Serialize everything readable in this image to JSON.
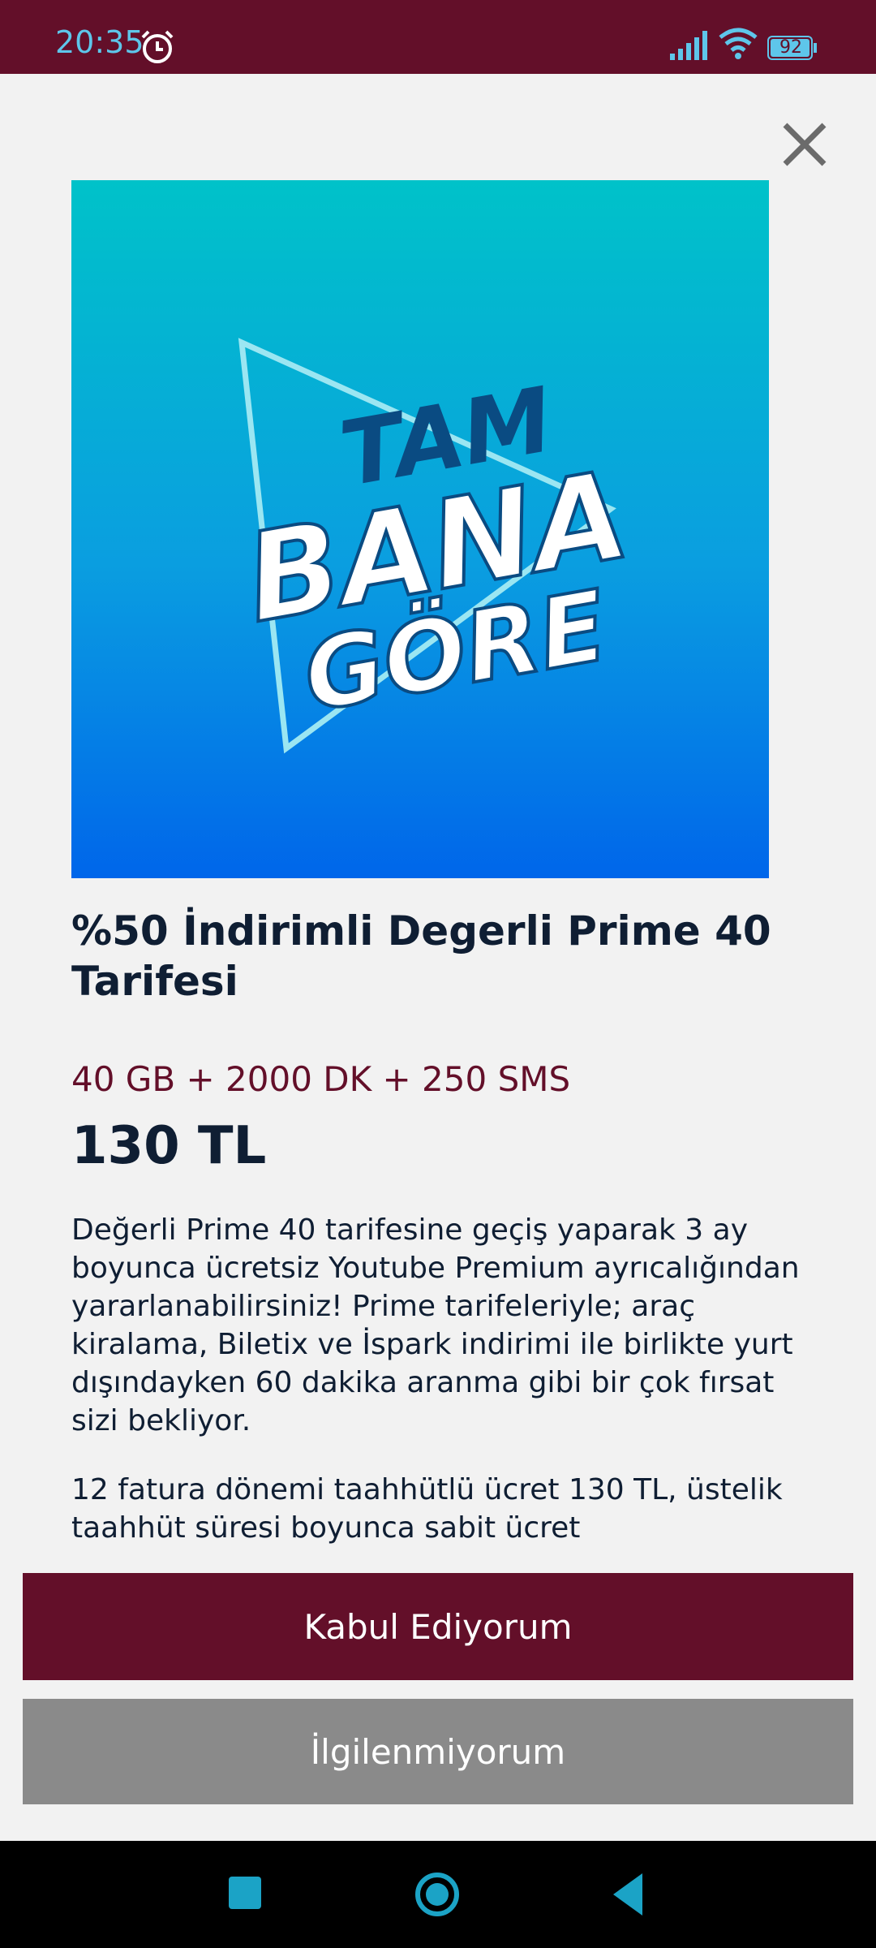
{
  "status_bar": {
    "time": "20:35",
    "battery_level": "92",
    "icons": [
      "alarm-icon",
      "signal-icon",
      "wifi-icon",
      "battery-icon"
    ]
  },
  "dialog": {
    "close_icon": "close-icon",
    "banner_text": [
      "TAM",
      "BANA",
      "GÖRE"
    ],
    "title": "%50 İndirimli Degerli Prime 40 Tarifesi",
    "specs": "40 GB + 2000 DK + 250 SMS",
    "price": "130 TL",
    "description": "Değerli Prime 40 tarifesine geçiş yaparak 3 ay boyunca ücretsiz Youtube Premium ayrıcalığından yararlanabilirsiniz! Prime tarifeleriyle; araç kiralama, Biletix ve İspark indirimi ile birlikte yurt dışındayken 60 dakika aranma gibi bir çok fırsat sizi bekliyor.",
    "note": "12 fatura dönemi taahhütlü ücret 130 TL, üstelik taahhüt süresi boyunca sabit ücret",
    "accept_label": "Kabul Ediyorum",
    "decline_label": "İlgilenmiyorum"
  },
  "nav_bar": {
    "icons": [
      "recents-icon",
      "home-icon",
      "back-icon"
    ]
  },
  "colors": {
    "brand": "#630f29",
    "decline": "#8a8a8a",
    "status_accent": "#5ec6ea"
  }
}
